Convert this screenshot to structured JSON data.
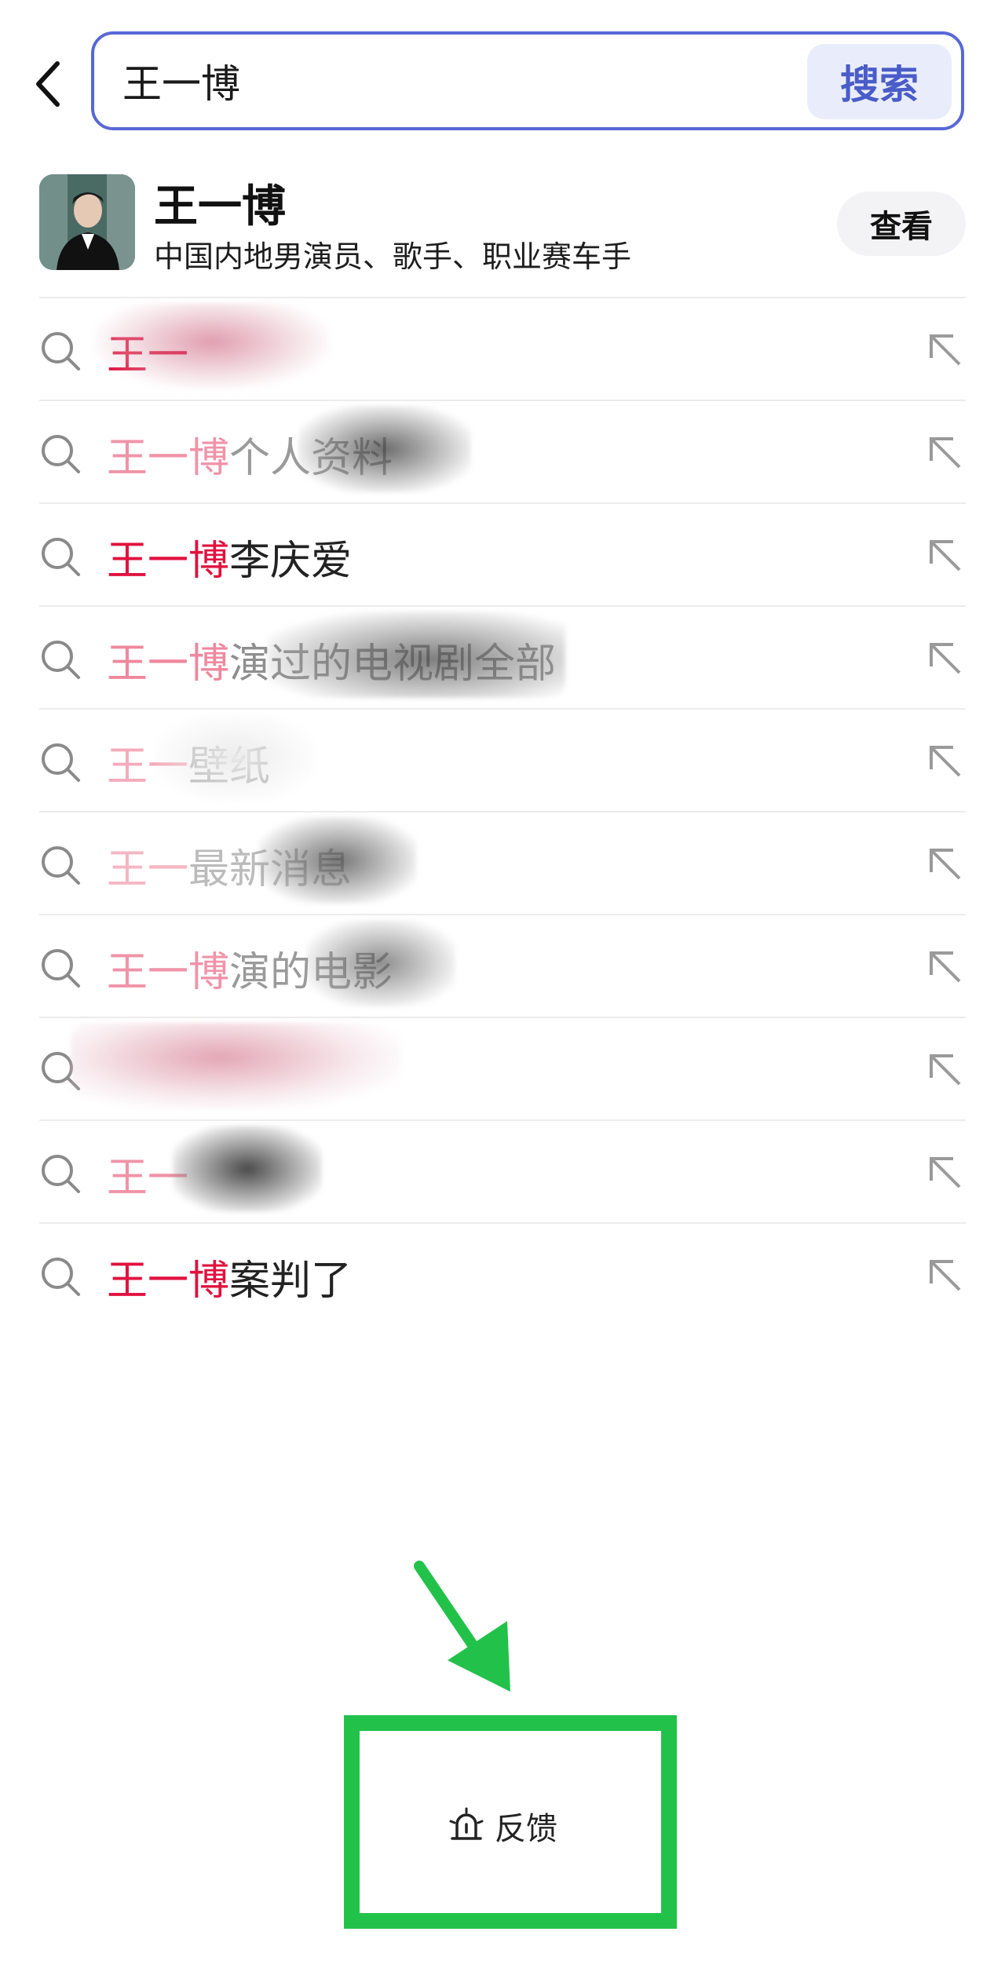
{
  "search": {
    "query": "王一博",
    "submit_label": "搜索",
    "back_icon": "chevron-left-icon"
  },
  "entity": {
    "name": "王一博",
    "description": "中国内地男演员、歌手、职业赛车手",
    "view_label": "查看"
  },
  "suggestions": [
    {
      "highlight": "王一",
      "rest": ""
    },
    {
      "highlight": "王一博",
      "rest": "个人资料"
    },
    {
      "highlight": "王一博",
      "rest": "李庆爱"
    },
    {
      "highlight": "王一博",
      "rest": "演过的电视剧全部"
    },
    {
      "highlight": "王一",
      "rest": "壁纸"
    },
    {
      "highlight": "王一",
      "rest": "最新消息"
    },
    {
      "highlight": "王一博",
      "rest": "演的电影"
    },
    {
      "highlight": "",
      "rest": ""
    },
    {
      "highlight": "王一",
      "rest": ""
    },
    {
      "highlight": "王一博",
      "rest": "案判了"
    }
  ],
  "feedback": {
    "label": "反馈",
    "icon": "feedback-icon"
  },
  "colors": {
    "accent": "#5868d6",
    "highlight": "#e0123f",
    "annotation": "#22c24a"
  }
}
